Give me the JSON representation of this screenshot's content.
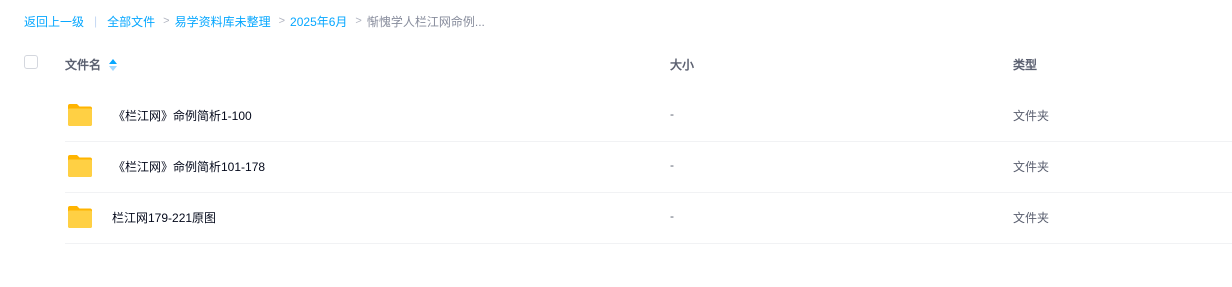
{
  "breadcrumb": {
    "back": "返回上一级",
    "separator_bar": "|",
    "items": [
      "全部文件",
      "易学资料库未整理",
      "2025年6月"
    ],
    "separator": ">",
    "current": "惭愧学人栏江网命例..."
  },
  "table": {
    "headers": {
      "name": "文件名",
      "size": "大小",
      "type": "类型"
    },
    "rows": [
      {
        "name": "《栏江网》命例简析1-100",
        "size": "-",
        "type": "文件夹",
        "icon": "folder-icon"
      },
      {
        "name": "《栏江网》命例简析101-178",
        "size": "-",
        "type": "文件夹",
        "icon": "folder-icon"
      },
      {
        "name": "栏江网179-221原图",
        "size": "-",
        "type": "文件夹",
        "icon": "folder-icon"
      }
    ]
  },
  "colors": {
    "link": "#06a7ff",
    "folder": "#ffc93a"
  }
}
